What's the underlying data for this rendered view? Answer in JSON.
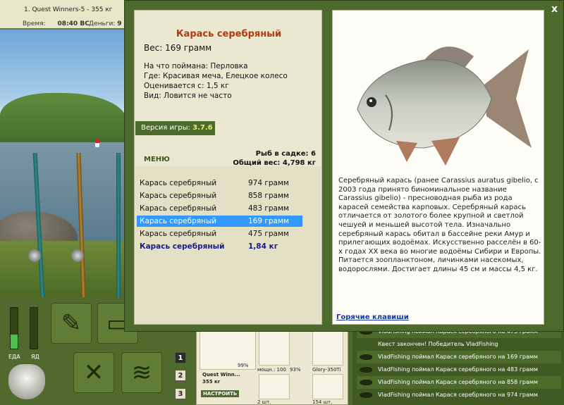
{
  "topbar": {
    "title": "1. Quest Winners-5 - 355 кг",
    "time_label": "Время:",
    "time_value": "08:40 ВС",
    "money_label": "Деньги:",
    "money_value": "9"
  },
  "side_labels": {
    "food": "ЕДА",
    "poison": "ЯД"
  },
  "nav_buttons": [
    "1",
    "2",
    "3"
  ],
  "tackle": {
    "rod_name": "Quest Winn...",
    "rod_weight": "355 кг",
    "rod_percent": "99%",
    "reel_info": "мощн.: 100",
    "reel_percent": "93%",
    "line_name": "Glory-350Ti",
    "hook_count": "2 шт.",
    "bait_count": "154 шт.",
    "setup_button": "НАСТРОИТЬ"
  },
  "feed": [
    "VladFishing поймал Карася серебряного на 475 грамм",
    "Квест закончен! Победитель VladFishing",
    "VladFishing поймал Карася серебряного на 169 грамм",
    "VladFishing поймал Карася серебряного на 483 грамм",
    "VladFishing поймал Карася серебряного на 858 грамм",
    "VladFishing поймал Карася серебряного на 974 грамм"
  ],
  "dialog": {
    "close": "x",
    "fish_title": "Карась серебряный",
    "fish_weight": "Вес: 169 грамм",
    "caught_on": "На что поймана: Перловка",
    "where": "Где: Красивая меча, Елецкое колесо",
    "value": "Оценивается с: 1,5 кг",
    "kind": "Вид: Ловится не часто",
    "version_label": "Версия игры:",
    "version_value": "3.7.6",
    "menu": "МЕНЮ",
    "fish_in_keepnet": "Рыб в садке: 6",
    "total_weight": "Общий вес: 4,798 кг",
    "catch_list": [
      {
        "name": "Карась серебряный",
        "weight": "974 грамм"
      },
      {
        "name": "Карась серебряный",
        "weight": "858 грамм"
      },
      {
        "name": "Карась серебряный",
        "weight": "483 грамм"
      },
      {
        "name": "Карась серебряный",
        "weight": "169 грамм"
      },
      {
        "name": "Карась серебряный",
        "weight": "475 грамм"
      }
    ],
    "catch_total": {
      "name": "Карась серебряный",
      "weight": "1,84 кг"
    },
    "description": "Серебряный карась (ранее Carassius auratus gibelio, с 2003 года принято биноминальное название Carassius gibelio) - пресноводная рыба из рода карасей семейства карповых. Серебряный карась отличается от золотого более крупной и светлой чешуей и меньшей высотой тела. Изначально серебряный карась обитал в бассейне реки Амур и прилегающих водоёмах. Искусственно расселён в 60-х годах XX века во многие водоёмы Сибири и Европы. Питается зоопланктоном, личинками насекомых, водорослями. Достигает длины 45 см и массы 4,5 кг.",
    "hotkeys": "Горячие клавиши"
  }
}
